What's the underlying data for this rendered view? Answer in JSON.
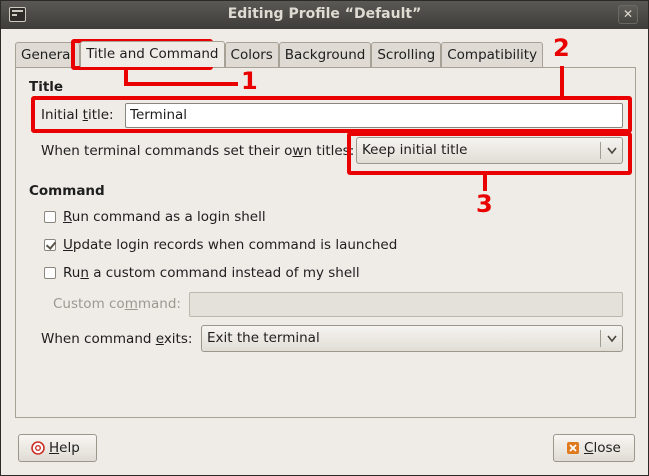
{
  "window": {
    "title": "Editing Profile “Default”"
  },
  "tabs": [
    {
      "label": "General"
    },
    {
      "label": "Title and Command"
    },
    {
      "label": "Colors"
    },
    {
      "label": "Background"
    },
    {
      "label": "Scrolling"
    },
    {
      "label": "Compatibility"
    }
  ],
  "title_section": {
    "heading": "Title",
    "initial_title_label_pre": "Initial ",
    "initial_title_label_u": "t",
    "initial_title_label_post": "itle:",
    "initial_title_value": "Terminal",
    "dynamic_label_pre": "When terminal commands set their o",
    "dynamic_label_u": "w",
    "dynamic_label_post": "n titles:",
    "dynamic_value": "Keep initial title"
  },
  "command_section": {
    "heading": "Command",
    "login_shell": {
      "u": "R",
      "rest": "un command as a login shell",
      "checked": false
    },
    "update_records": {
      "u": "U",
      "rest": "pdate login records when command is launched",
      "checked": true
    },
    "custom_cmd": {
      "pre": "Ru",
      "u": "n",
      "rest": " a custom command instead of my shell",
      "checked": false
    },
    "custom_label_pre": "Custom co",
    "custom_label_u": "m",
    "custom_label_post": "mand:",
    "custom_value": "",
    "exit_label_pre": "When command ",
    "exit_label_u": "e",
    "exit_label_post": "xits:",
    "exit_value": "Exit the terminal"
  },
  "buttons": {
    "help_u": "H",
    "help_rest": "elp",
    "close_u": "C",
    "close_rest": "lose"
  },
  "annotations": [
    "1",
    "2",
    "3"
  ],
  "colors": {
    "annotation": "#e90000",
    "window_bg": "#efebe7",
    "titlebar": "#3e3d39"
  }
}
